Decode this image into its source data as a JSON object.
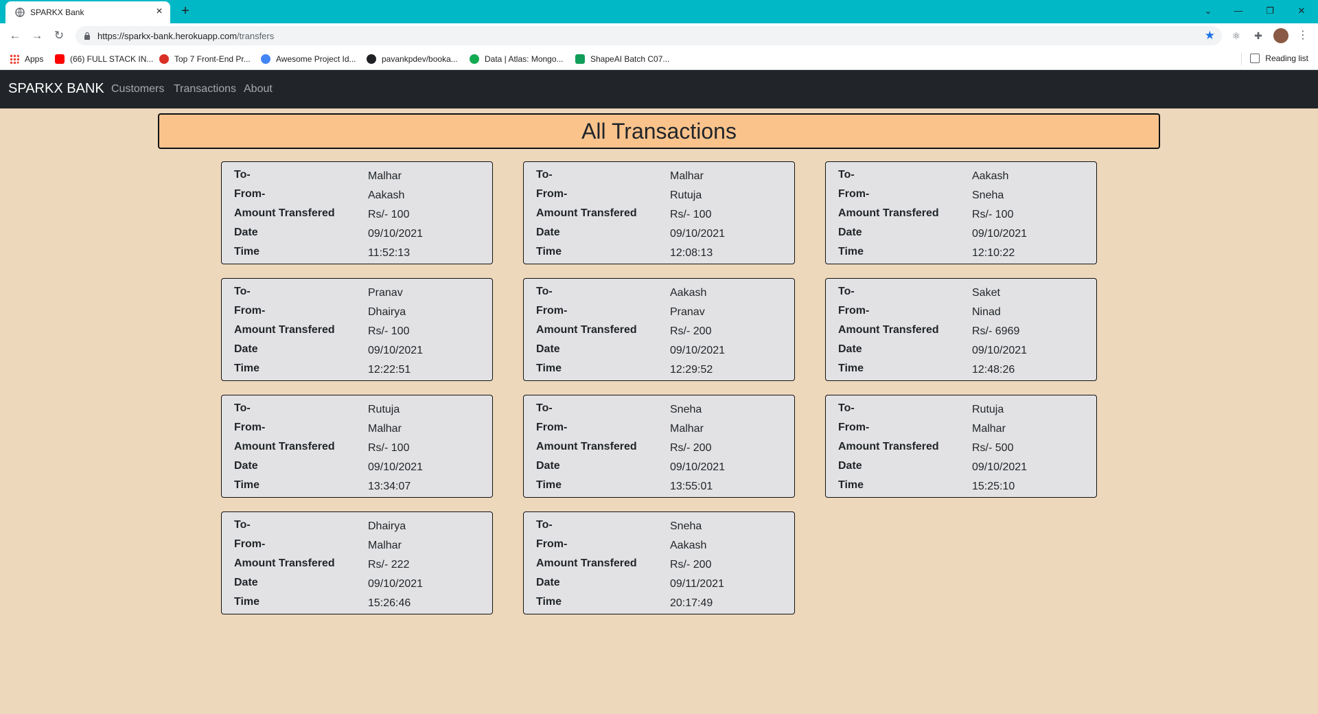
{
  "browser": {
    "tab_title": "SPARKX Bank",
    "url_host": "https://sparkx-bank.herokuapp.com",
    "url_path": "/transfers",
    "bookmarks": [
      {
        "label": "Apps",
        "color": "#ea4335"
      },
      {
        "label": "(66) FULL STACK IN...",
        "color": "#ff0000"
      },
      {
        "label": "Top 7 Front-End Pr...",
        "color": "#d93025"
      },
      {
        "label": "Awesome Project Id...",
        "color": "#4285f4"
      },
      {
        "label": "pavankpdev/booka...",
        "color": "#202124"
      },
      {
        "label": "Data | Atlas: Mongo...",
        "color": "#13aa52"
      },
      {
        "label": "ShapeAI Batch C07...",
        "color": "#0f9d58"
      }
    ],
    "reading_list": "Reading list"
  },
  "navbar": {
    "brand": "SPARKX BANK",
    "links": [
      "Customers",
      "Transactions",
      "About"
    ]
  },
  "page_title": "All Transactions",
  "labels": {
    "to": "To-",
    "from": "From-",
    "amount": "Amount Transfered",
    "date": "Date",
    "time": "Time"
  },
  "transactions": [
    {
      "to": "Malhar",
      "from": "Aakash",
      "amount": "Rs/- 100",
      "date": "09/10/2021",
      "time": "11:52:13"
    },
    {
      "to": "Malhar",
      "from": "Rutuja",
      "amount": "Rs/- 100",
      "date": "09/10/2021",
      "time": "12:08:13"
    },
    {
      "to": "Aakash",
      "from": "Sneha",
      "amount": "Rs/- 100",
      "date": "09/10/2021",
      "time": "12:10:22"
    },
    {
      "to": "Pranav",
      "from": "Dhairya",
      "amount": "Rs/- 100",
      "date": "09/10/2021",
      "time": "12:22:51"
    },
    {
      "to": "Aakash",
      "from": "Pranav",
      "amount": "Rs/- 200",
      "date": "09/10/2021",
      "time": "12:29:52"
    },
    {
      "to": "Saket",
      "from": "Ninad",
      "amount": "Rs/- 6969",
      "date": "09/10/2021",
      "time": "12:48:26"
    },
    {
      "to": "Rutuja",
      "from": "Malhar",
      "amount": "Rs/- 100",
      "date": "09/10/2021",
      "time": "13:34:07"
    },
    {
      "to": "Sneha",
      "from": "Malhar",
      "amount": "Rs/- 200",
      "date": "09/10/2021",
      "time": "13:55:01"
    },
    {
      "to": "Rutuja",
      "from": "Malhar",
      "amount": "Rs/- 500",
      "date": "09/10/2021",
      "time": "15:25:10"
    },
    {
      "to": "Dhairya",
      "from": "Malhar",
      "amount": "Rs/- 222",
      "date": "09/10/2021",
      "time": "15:26:46"
    },
    {
      "to": "Sneha",
      "from": "Aakash",
      "amount": "Rs/- 200",
      "date": "09/11/2021",
      "time": "20:17:49"
    }
  ]
}
